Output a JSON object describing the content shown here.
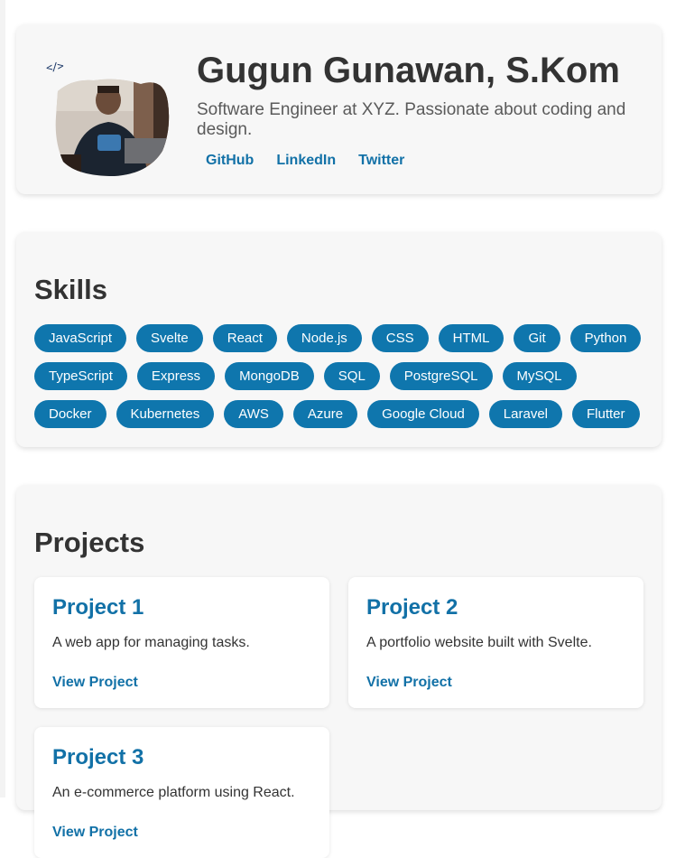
{
  "profile": {
    "logo_text": "</>",
    "name": "Gugun Gunawan, S.Kom",
    "tagline": "Software Engineer at XYZ. Passionate about coding and design.",
    "links": [
      "GitHub",
      "LinkedIn",
      "Twitter"
    ]
  },
  "skills": {
    "title": "Skills",
    "items": [
      "JavaScript",
      "Svelte",
      "React",
      "Node.js",
      "CSS",
      "HTML",
      "Git",
      "Python",
      "TypeScript",
      "Express",
      "MongoDB",
      "SQL",
      "PostgreSQL",
      "MySQL",
      "Docker",
      "Kubernetes",
      "AWS",
      "Azure",
      "Google Cloud",
      "Laravel",
      "Flutter"
    ]
  },
  "projects": {
    "title": "Projects",
    "items": [
      {
        "title": "Project 1",
        "description": "A web app for managing tasks.",
        "link": "View Project"
      },
      {
        "title": "Project 2",
        "description": "A portfolio website built with Svelte.",
        "link": "View Project"
      },
      {
        "title": "Project 3",
        "description": "An e-commerce platform using React.",
        "link": "View Project"
      }
    ]
  },
  "colors": {
    "accent": "#1271a7",
    "tag_bg": "#0f76ad",
    "card_bg": "#f7f7f7"
  }
}
